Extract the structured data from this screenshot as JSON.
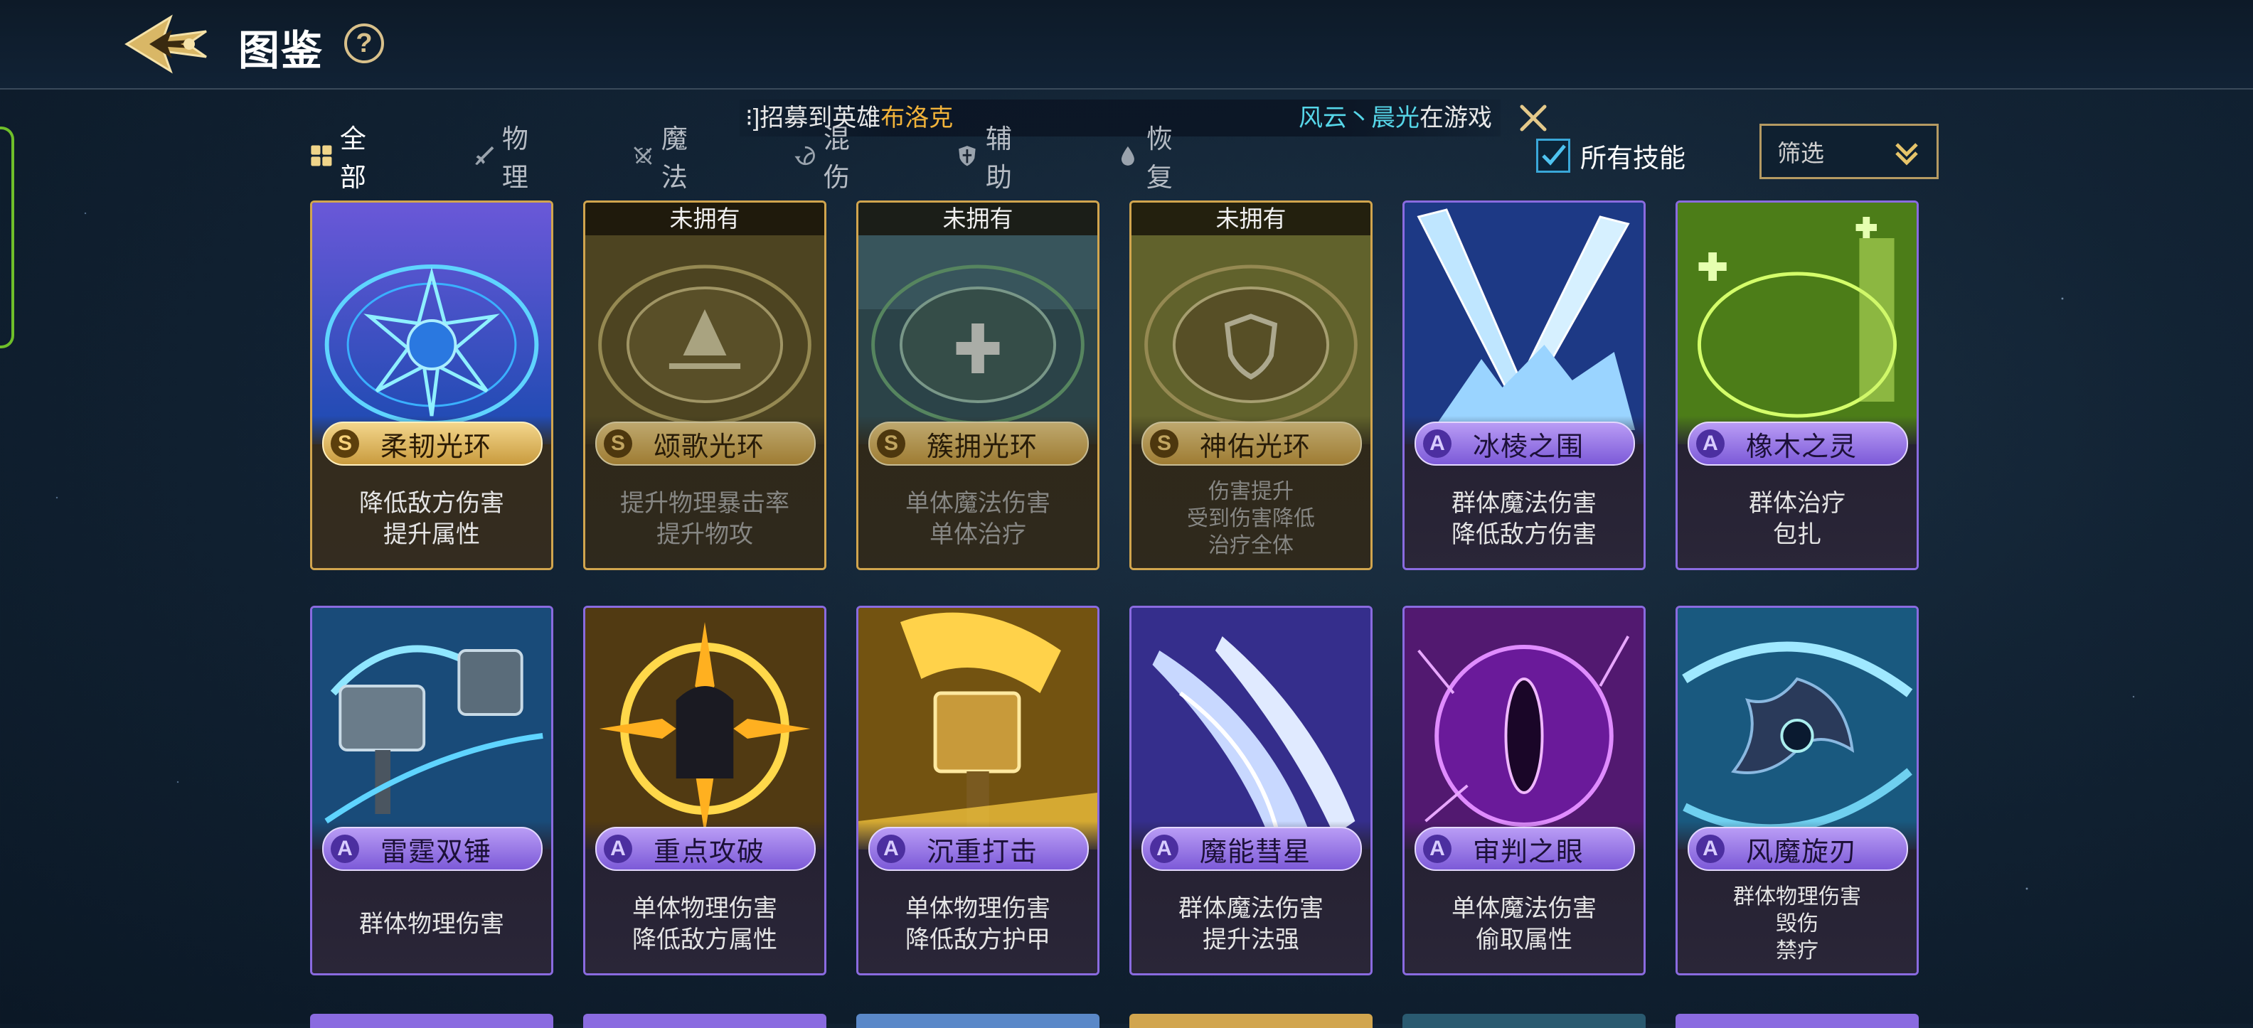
{
  "header": {
    "title": "图鉴",
    "help": "?"
  },
  "ticker": {
    "left_prefix": "⁝]招募到英雄",
    "left_hero": "布洛克",
    "right_name": "风云丶晨光",
    "right_suffix": "在游戏"
  },
  "tabs": [
    {
      "label": "全部",
      "icon": "grid-icon",
      "active": true
    },
    {
      "label": "物理",
      "icon": "sword-icon",
      "active": false
    },
    {
      "label": "魔法",
      "icon": "magic-icon",
      "active": false
    },
    {
      "label": "混伤",
      "icon": "swirl-icon",
      "active": false
    },
    {
      "label": "辅助",
      "icon": "shield-icon",
      "active": false
    },
    {
      "label": "恢复",
      "icon": "drop-icon",
      "active": false
    }
  ],
  "all_skills": {
    "label": "所有技能",
    "checked": true
  },
  "filter": {
    "label": "筛选"
  },
  "colors": {
    "s_border": "#d1a54e",
    "a_border": "#8a6be0",
    "accent_gold": "#f2b33a",
    "accent_cyan": "#56d6e8"
  },
  "cards": [
    {
      "grade": "S",
      "name": "柔韧光环",
      "owned": true,
      "unowned_label": "",
      "desc": [
        "降低敌方伤害",
        "提升属性"
      ],
      "art": "blue-star-circle"
    },
    {
      "grade": "S",
      "name": "颂歌光环",
      "owned": false,
      "unowned_label": "未拥有",
      "desc": [
        "提升物理暴击率",
        "提升物攻"
      ],
      "art": "gold-burst-circle"
    },
    {
      "grade": "S",
      "name": "簇拥光环",
      "owned": false,
      "unowned_label": "未拥有",
      "desc": [
        "单体魔法伤害",
        "单体治疗"
      ],
      "art": "teal-cross-circle"
    },
    {
      "grade": "S",
      "name": "神佑光环",
      "owned": false,
      "unowned_label": "未拥有",
      "desc": [
        "伤害提升",
        "受到伤害降低",
        "治疗全体"
      ],
      "art": "yellow-shield-circle"
    },
    {
      "grade": "A",
      "name": "冰棱之围",
      "owned": true,
      "unowned_label": "",
      "desc": [
        "群体魔法伤害",
        "降低敌方伤害"
      ],
      "art": "ice-swords"
    },
    {
      "grade": "A",
      "name": "橡木之灵",
      "owned": true,
      "unowned_label": "",
      "desc": [
        "群体治疗",
        "包扎"
      ],
      "art": "green-runes"
    },
    {
      "grade": "A",
      "name": "雷霆双锤",
      "owned": true,
      "unowned_label": "",
      "desc": [
        "群体物理伤害"
      ],
      "art": "twin-hammers"
    },
    {
      "grade": "A",
      "name": "重点攻破",
      "owned": true,
      "unowned_label": "",
      "desc": [
        "单体物理伤害",
        "降低敌方属性"
      ],
      "art": "target-ring"
    },
    {
      "grade": "A",
      "name": "沉重打击",
      "owned": true,
      "unowned_label": "",
      "desc": [
        "单体物理伤害",
        "降低敌方护甲"
      ],
      "art": "golden-hammer"
    },
    {
      "grade": "A",
      "name": "魔能彗星",
      "owned": true,
      "unowned_label": "",
      "desc": [
        "群体魔法伤害",
        "提升法强"
      ],
      "art": "comet-claws"
    },
    {
      "grade": "A",
      "name": "审判之眼",
      "owned": true,
      "unowned_label": "",
      "desc": [
        "单体魔法伤害",
        "偷取属性"
      ],
      "art": "purple-eye"
    },
    {
      "grade": "A",
      "name": "风魔旋刃",
      "owned": true,
      "unowned_label": "",
      "desc": [
        "群体物理伤害",
        "毁伤",
        "禁疗"
      ],
      "art": "wind-shuriken"
    }
  ]
}
